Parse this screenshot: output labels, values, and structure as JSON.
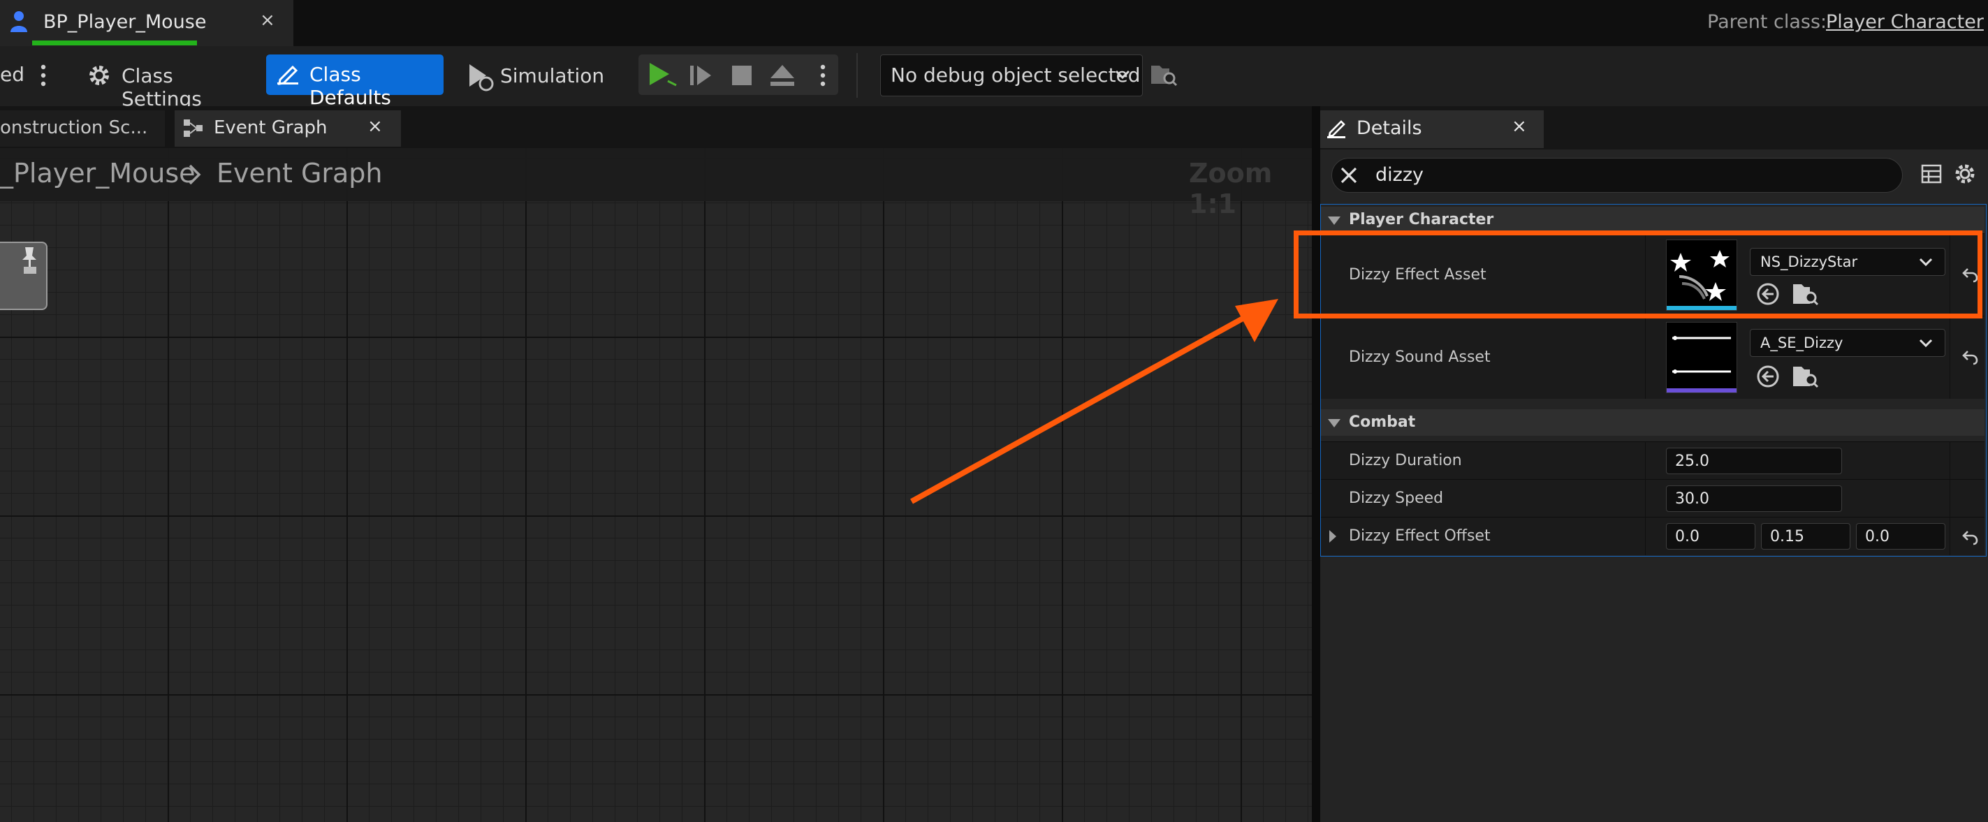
{
  "tab": {
    "title": "BP_Player_Mouse",
    "close": "×"
  },
  "parent_class": {
    "label": "Parent class:",
    "value": "Player Character"
  },
  "toolbar": {
    "left_cut_label": "ed",
    "class_settings": "Class Settings",
    "class_defaults": "Class Defaults",
    "simulation": "Simulation",
    "debug_select": "No debug object selected"
  },
  "graph_tabs": {
    "construction": "onstruction Sc...",
    "event_graph": "Event Graph",
    "close": "×"
  },
  "breadcrumb": {
    "blueprint": "_Player_Mouse",
    "graph": "Event Graph"
  },
  "zoom": "Zoom 1:1",
  "details": {
    "title": "Details",
    "close": "×",
    "search_value": "dizzy",
    "categories": [
      {
        "label": "Player Character"
      },
      {
        "label": "Combat"
      }
    ],
    "effect_asset": {
      "label": "Dizzy Effect Asset",
      "value": "NS_DizzyStar"
    },
    "sound_asset": {
      "label": "Dizzy Sound Asset",
      "value": "A_SE_Dizzy"
    },
    "duration": {
      "label": "Dizzy Duration",
      "value": "25.0"
    },
    "speed": {
      "label": "Dizzy Speed",
      "value": "30.0"
    },
    "offset": {
      "label": "Dizzy Effect Offset",
      "x": "0.0",
      "y": "0.15",
      "z": "0.0"
    }
  },
  "colors": {
    "accent_blue": "#0b6cd8",
    "tab_green": "#23b31b",
    "highlight_orange": "#ff5a0a",
    "play_green": "#4caf2e"
  }
}
